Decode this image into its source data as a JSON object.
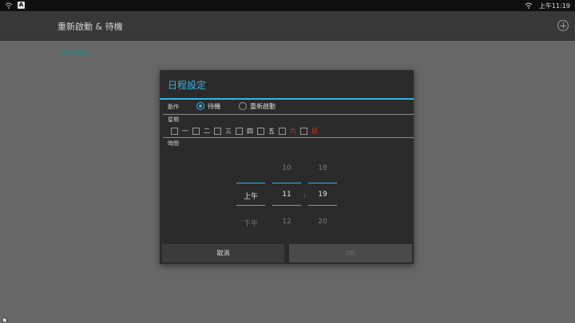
{
  "status": {
    "time": "上午11:19"
  },
  "header": {
    "title": "重新啟動 & 待機"
  },
  "section": {
    "label": "電源日程表"
  },
  "dialog": {
    "title": "日程設定",
    "action_label": "動作",
    "options": [
      {
        "label": "待機",
        "selected": true
      },
      {
        "label": "重新啟動",
        "selected": false
      }
    ],
    "week_label": "星期",
    "days": [
      "一",
      "二",
      "三",
      "四",
      "五",
      "六",
      "日"
    ],
    "time_label": "時間",
    "picker": {
      "ampm": [
        "",
        "上午",
        "下午"
      ],
      "hour": [
        "10",
        "11",
        "12"
      ],
      "minute": [
        "18",
        "19",
        "20"
      ],
      "separator": ":"
    },
    "cancel_label": "取消",
    "ok_label": "OK"
  },
  "colors": {
    "accent": "#33b5e5",
    "weekend": "#e8392b",
    "section": "#1e8a8a"
  }
}
